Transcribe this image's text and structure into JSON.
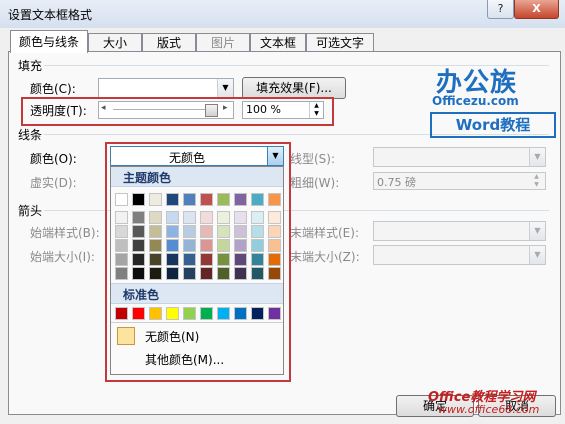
{
  "window": {
    "title": "设置文本框格式",
    "help_label": "?",
    "close_label": "X"
  },
  "tabs": [
    {
      "label": "颜色与线条"
    },
    {
      "label": "大小"
    },
    {
      "label": "版式"
    },
    {
      "label": "图片"
    },
    {
      "label": "文本框"
    },
    {
      "label": "可选文字"
    }
  ],
  "fill": {
    "section_label": "填充",
    "color_label": "颜色(C):",
    "fill_effects_label": "填充效果(F)...",
    "transparency_label": "透明度(T):",
    "transparency_value": "100 %",
    "transparency_level": 1.0
  },
  "line": {
    "section_label": "线条",
    "color_label": "颜色(O):",
    "color_value": "无颜色",
    "dash_label": "虚实(D):",
    "style_label": "线型(S):",
    "weight_label": "粗细(W):",
    "weight_value": "0.75 磅"
  },
  "arrows": {
    "section_label": "箭头",
    "begin_style_label": "始端样式(B):",
    "begin_size_label": "始端大小(I):",
    "end_style_label": "末端样式(E):",
    "end_size_label": "末端大小(Z):"
  },
  "palette": {
    "theme_label": "主题颜色",
    "standard_label": "标准色",
    "no_color_label": "无颜色(N)",
    "more_colors_label": "其他颜色(M)...",
    "theme_top": [
      "#ffffff",
      "#000000",
      "#eeece1",
      "#1f497d",
      "#4f81bd",
      "#c0504d",
      "#9bbb59",
      "#8064a2",
      "#4bacc6",
      "#f79646"
    ],
    "theme_shades": [
      [
        "#f2f2f2",
        "#d8d8d8",
        "#bfbfbf",
        "#a5a5a5",
        "#7f7f7f"
      ],
      [
        "#7f7f7f",
        "#595959",
        "#3f3f3f",
        "#262626",
        "#0c0c0c"
      ],
      [
        "#ddd9c3",
        "#c4bd97",
        "#938953",
        "#494429",
        "#1d1b10"
      ],
      [
        "#c6d9f0",
        "#8db3e2",
        "#548dd4",
        "#17365d",
        "#0f243e"
      ],
      [
        "#dbe5f1",
        "#b8cce4",
        "#95b3d7",
        "#366092",
        "#244061"
      ],
      [
        "#f2dcdb",
        "#e5b9b7",
        "#d99694",
        "#953734",
        "#632423"
      ],
      [
        "#ebf1dd",
        "#d7e3bc",
        "#c3d69b",
        "#76923c",
        "#4f6128"
      ],
      [
        "#e5e0ec",
        "#ccc1d9",
        "#b2a2c7",
        "#5f497a",
        "#3f3151"
      ],
      [
        "#dbeef3",
        "#b7dde8",
        "#92cddc",
        "#31859b",
        "#205867"
      ],
      [
        "#fdeada",
        "#fbd5b5",
        "#fac08f",
        "#e36c09",
        "#974806"
      ]
    ],
    "standard": [
      "#c00000",
      "#ff0000",
      "#ffc000",
      "#ffff00",
      "#92d050",
      "#00b050",
      "#00b0f0",
      "#0070c0",
      "#002060",
      "#7030a0"
    ],
    "no_color_swatch": "#fbe3a0"
  },
  "watermark": {
    "brand_cn": "办公族",
    "brand_url": "Officezu.com",
    "brand_word": "Word教程",
    "site_cn": "Office教程学习网",
    "site_url": "www.office68.com"
  },
  "footer": {
    "ok_label": "确定",
    "cancel_label": "取消"
  },
  "colors": {
    "highlight": "#c43a3a",
    "accent": "#1e6fc0"
  }
}
